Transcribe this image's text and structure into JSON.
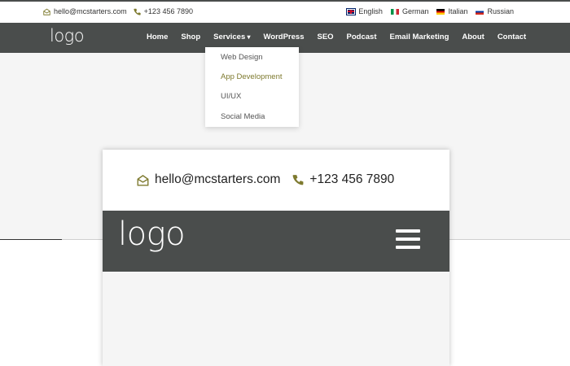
{
  "topbar": {
    "email": "hello@mcstarters.com",
    "phone": "+123 456 7890",
    "languages": [
      {
        "label": "English",
        "icon": "flag-uk-icon"
      },
      {
        "label": "German",
        "icon": "flag-italy-icon"
      },
      {
        "label": "Italian",
        "icon": "flag-germany-icon"
      },
      {
        "label": "Russian",
        "icon": "flag-russia-icon"
      }
    ]
  },
  "navbar": {
    "logo": "logo",
    "menu": [
      "Home",
      "Shop",
      "Services",
      "WordPress",
      "SEO",
      "Podcast",
      "Email Marketing",
      "About",
      "Contact"
    ]
  },
  "dropdown": {
    "items": [
      "Web Design",
      "App Development",
      "UI/UX",
      "Social Media"
    ],
    "active_item": "App Development"
  },
  "mobile_preview": {
    "email": "hello@mcstarters.com",
    "phone": "+123 456 7890",
    "logo": "logo",
    "menu_icon": "hamburger-icon"
  },
  "colors": {
    "nav_bg": "#4a4d4c",
    "accent": "#7e7a2f",
    "page_bg": "#f5f5f5"
  }
}
